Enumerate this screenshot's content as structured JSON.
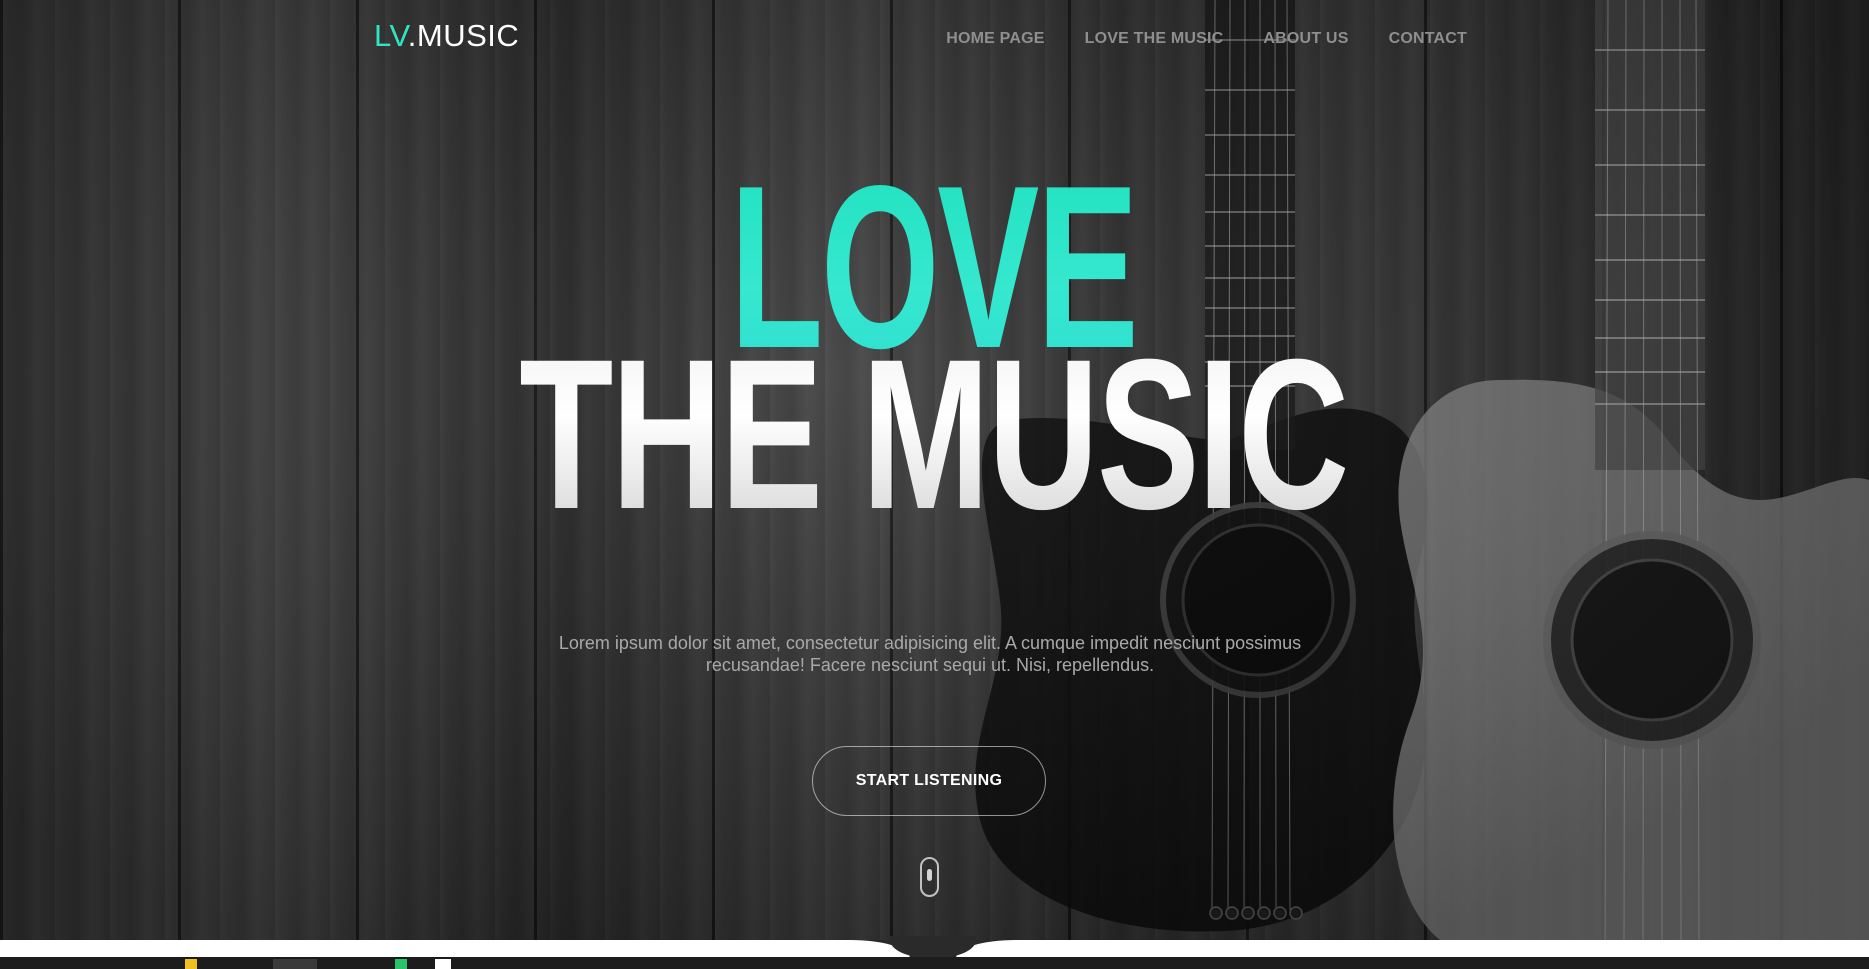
{
  "brand": {
    "logo_accent": "LV",
    "logo_rest": ".MUSIC",
    "accent_color": "#2ee5c4"
  },
  "nav": {
    "items": [
      {
        "label": "HOME PAGE"
      },
      {
        "label": "LOVE THE MUSIC"
      },
      {
        "label": "ABOUT US"
      },
      {
        "label": "CONTACT"
      }
    ]
  },
  "hero": {
    "headline_top": "LOVE",
    "headline_bottom": "THE MUSIC",
    "tagline_line1": "Lorem ipsum dolor sit amet, consectetur adipisicing elit. A cumque impedit nesciunt possimus",
    "tagline_line2": "recusandae! Facere nesciunt sequi ut. Nisi, repellendus.",
    "cta_label": "START LISTENING",
    "scroll_indicator_icon": "mouse-scroll-icon"
  }
}
